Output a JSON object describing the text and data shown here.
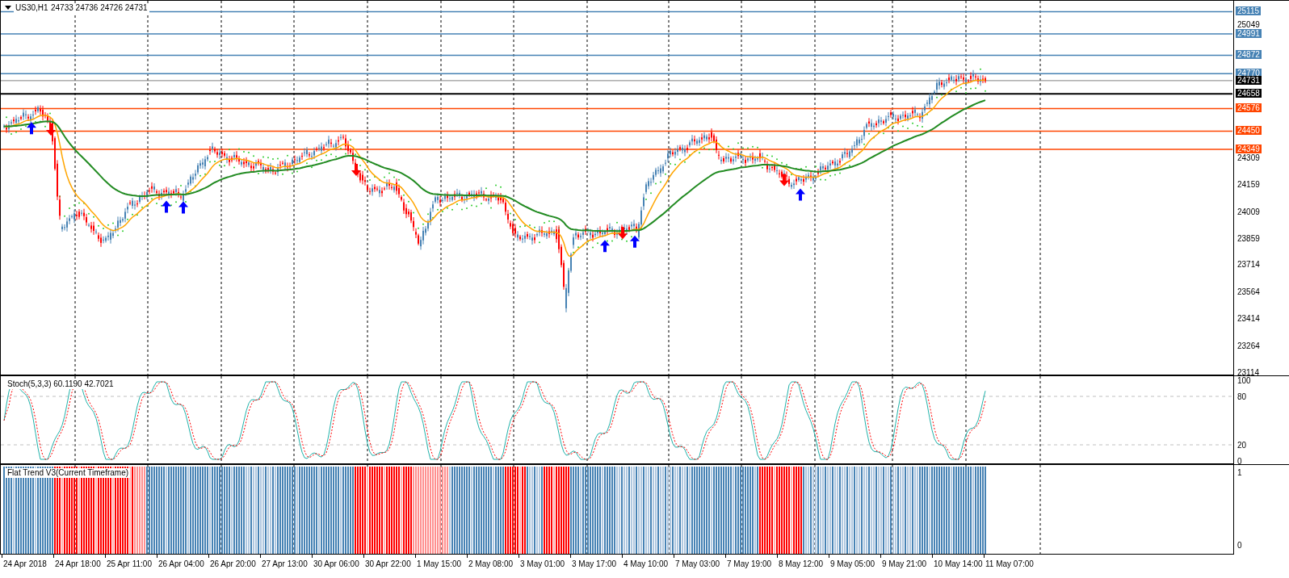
{
  "header": {
    "symbol": "US30,H1",
    "ohlc": "24733 24736 24726 24731"
  },
  "price_axis": {
    "ticks": [
      "25049",
      "24309",
      "24159",
      "24009",
      "23859",
      "23714",
      "23564",
      "23414",
      "23264",
      "23114"
    ],
    "levels": [
      {
        "label": "25115",
        "color": "#4682b4",
        "kind": "level"
      },
      {
        "label": "24991",
        "color": "#4682b4",
        "kind": "level"
      },
      {
        "label": "24872",
        "color": "#4682b4",
        "kind": "level"
      },
      {
        "label": "24770",
        "color": "#4682b4",
        "kind": "level"
      },
      {
        "label": "24731",
        "color": "#000000",
        "kind": "bid"
      },
      {
        "label": "24658",
        "color": "#000000",
        "kind": "level"
      },
      {
        "label": "24576",
        "color": "#ff4500",
        "kind": "level"
      },
      {
        "label": "24450",
        "color": "#ff4500",
        "kind": "level"
      },
      {
        "label": "24349",
        "color": "#ff4500",
        "kind": "level"
      }
    ]
  },
  "stochastic": {
    "title": "Stoch(5,3,3) 60.1190 42.7021",
    "ticks": [
      "100",
      "80",
      "20",
      "0"
    ]
  },
  "flat_trend": {
    "title": "Flat Trend V3(Current Timeframe)",
    "ticks": [
      "1",
      "0"
    ]
  },
  "time_axis": [
    "24 Apr 2018",
    "24 Apr 18:00",
    "25 Apr 11:00",
    "26 Apr 04:00",
    "26 Apr 20:00",
    "27 Apr 13:00",
    "30 Apr 06:00",
    "30 Apr 22:00",
    "1 May 15:00",
    "2 May 08:00",
    "3 May 01:00",
    "3 May 17:00",
    "4 May 10:00",
    "7 May 03:00",
    "7 May 19:00",
    "8 May 12:00",
    "9 May 05:00",
    "9 May 21:00",
    "10 May 14:00",
    "11 May 07:00"
  ]
}
